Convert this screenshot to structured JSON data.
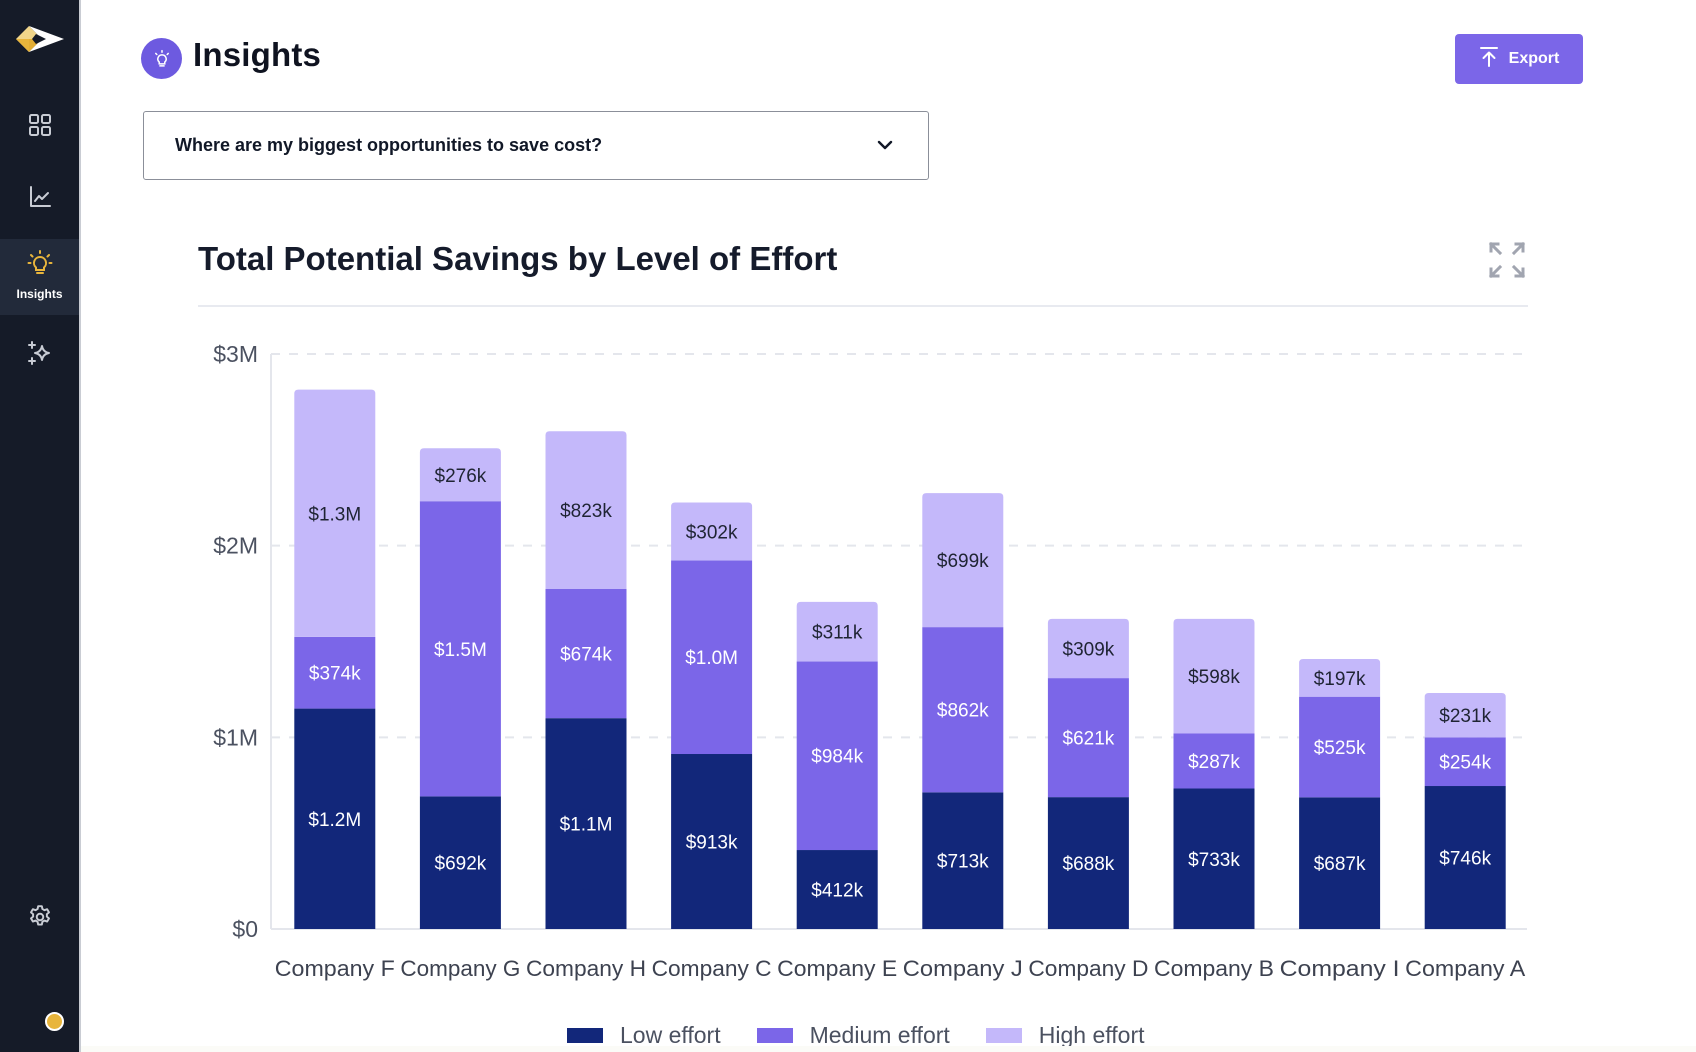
{
  "sidebar": {
    "items": [
      {
        "name": "dashboard",
        "icon": "grid-icon"
      },
      {
        "name": "analytics",
        "icon": "line-chart-icon"
      },
      {
        "name": "insights",
        "icon": "lightbulb-icon",
        "label": "Insights",
        "active": true
      },
      {
        "name": "ai-features",
        "icon": "sparkle-icon"
      }
    ],
    "settings_icon": "gear-icon",
    "status_color": "#e8b53c"
  },
  "header": {
    "title": "Insights",
    "export_label": "Export"
  },
  "question_select": {
    "value": "Where are my biggest opportunities to save cost?"
  },
  "colors": {
    "low": "#12277a",
    "medium": "#7b66e8",
    "high": "#c4b8fa",
    "accent": "#7b66e8"
  },
  "chart_data": {
    "type": "bar",
    "stacked": true,
    "title": "Total Potential Savings by Level of Effort",
    "xlabel": "",
    "ylabel": "",
    "ylim": [
      0,
      3000000
    ],
    "yticks": [
      0,
      1000000,
      2000000,
      3000000
    ],
    "ytick_labels": [
      "$0",
      "$1M",
      "$2M",
      "$3M"
    ],
    "grid": true,
    "legend_position": "bottom",
    "categories": [
      "Company F",
      "Company G",
      "Company H",
      "Company C",
      "Company E",
      "Company J",
      "Company D",
      "Company B",
      "Company I",
      "Company A"
    ],
    "series": [
      {
        "name": "Low effort",
        "values": [
          1150000,
          692000,
          1100000,
          913000,
          412000,
          713000,
          688000,
          733000,
          687000,
          746000
        ],
        "labels": [
          "$1.2M",
          "$692k",
          "$1.1M",
          "$913k",
          "$412k",
          "$713k",
          "$688k",
          "$733k",
          "$687k",
          "$746k"
        ]
      },
      {
        "name": "Medium effort",
        "values": [
          374000,
          1540000,
          674000,
          1010000,
          984000,
          862000,
          621000,
          287000,
          525000,
          254000
        ],
        "labels": [
          "$374k",
          "$1.5M",
          "$674k",
          "$1.0M",
          "$984k",
          "$862k",
          "$621k",
          "$287k",
          "$525k",
          "$254k"
        ]
      },
      {
        "name": "High effort",
        "values": [
          1290000,
          276000,
          823000,
          302000,
          311000,
          699000,
          309000,
          598000,
          197000,
          231000
        ],
        "labels": [
          "$1.3M",
          "$276k",
          "$823k",
          "$302k",
          "$311k",
          "$699k",
          "$309k",
          "$598k",
          "$197k",
          "$231k"
        ]
      }
    ]
  }
}
